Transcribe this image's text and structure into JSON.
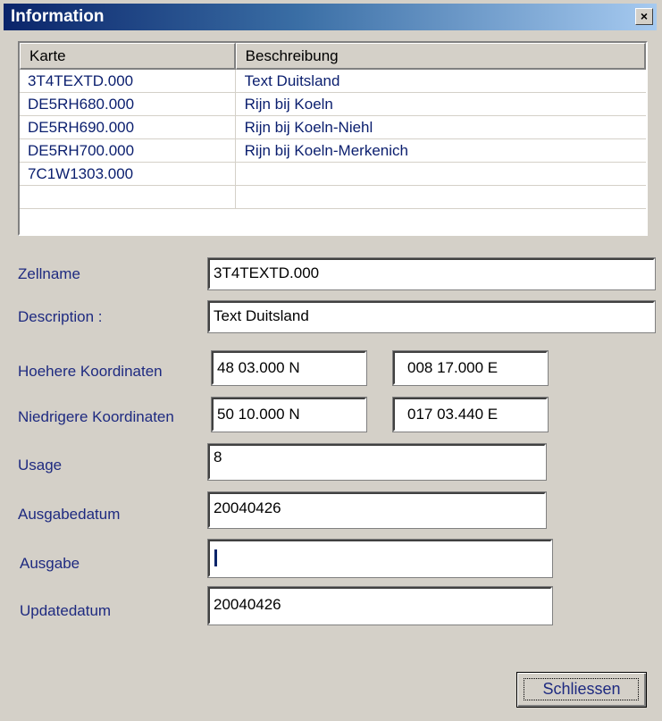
{
  "window": {
    "title": "Information",
    "close_symbol": "×"
  },
  "list": {
    "columns": [
      "Karte",
      "Beschreibung"
    ],
    "rows": [
      [
        "3T4TEXTD.000",
        "Text Duitsland"
      ],
      [
        "DE5RH680.000",
        "Rijn bij Koeln"
      ],
      [
        "DE5RH690.000",
        "Rijn bij Koeln-Niehl"
      ],
      [
        "DE5RH700.000",
        "Rijn bij Koeln-Merkenich"
      ],
      [
        "7C1W1303.000",
        ""
      ],
      [
        "",
        ""
      ]
    ]
  },
  "form": {
    "zellname_label": "Zellname",
    "zellname_value": "3T4TEXTD.000",
    "description_label": "Description :",
    "description_value": "Text Duitsland",
    "hoehere_label": "Hoehere Koordinaten",
    "hoehere_lat": "48 03.000 N",
    "hoehere_lon": "008 17.000 E",
    "niedrigere_label": "Niedrigere Koordinaten",
    "niedrigere_lat": "50 10.000 N",
    "niedrigere_lon": "017 03.440 E",
    "usage_label": "Usage",
    "usage_value": "8",
    "ausgabedatum_label": "Ausgabedatum",
    "ausgabedatum_value": "20040426",
    "ausgabe_label": "Ausgabe",
    "ausgabe_value": "",
    "updatedatum_label": "Updatedatum",
    "updatedatum_value": "20040426"
  },
  "buttons": {
    "close_label": "Schliessen"
  }
}
